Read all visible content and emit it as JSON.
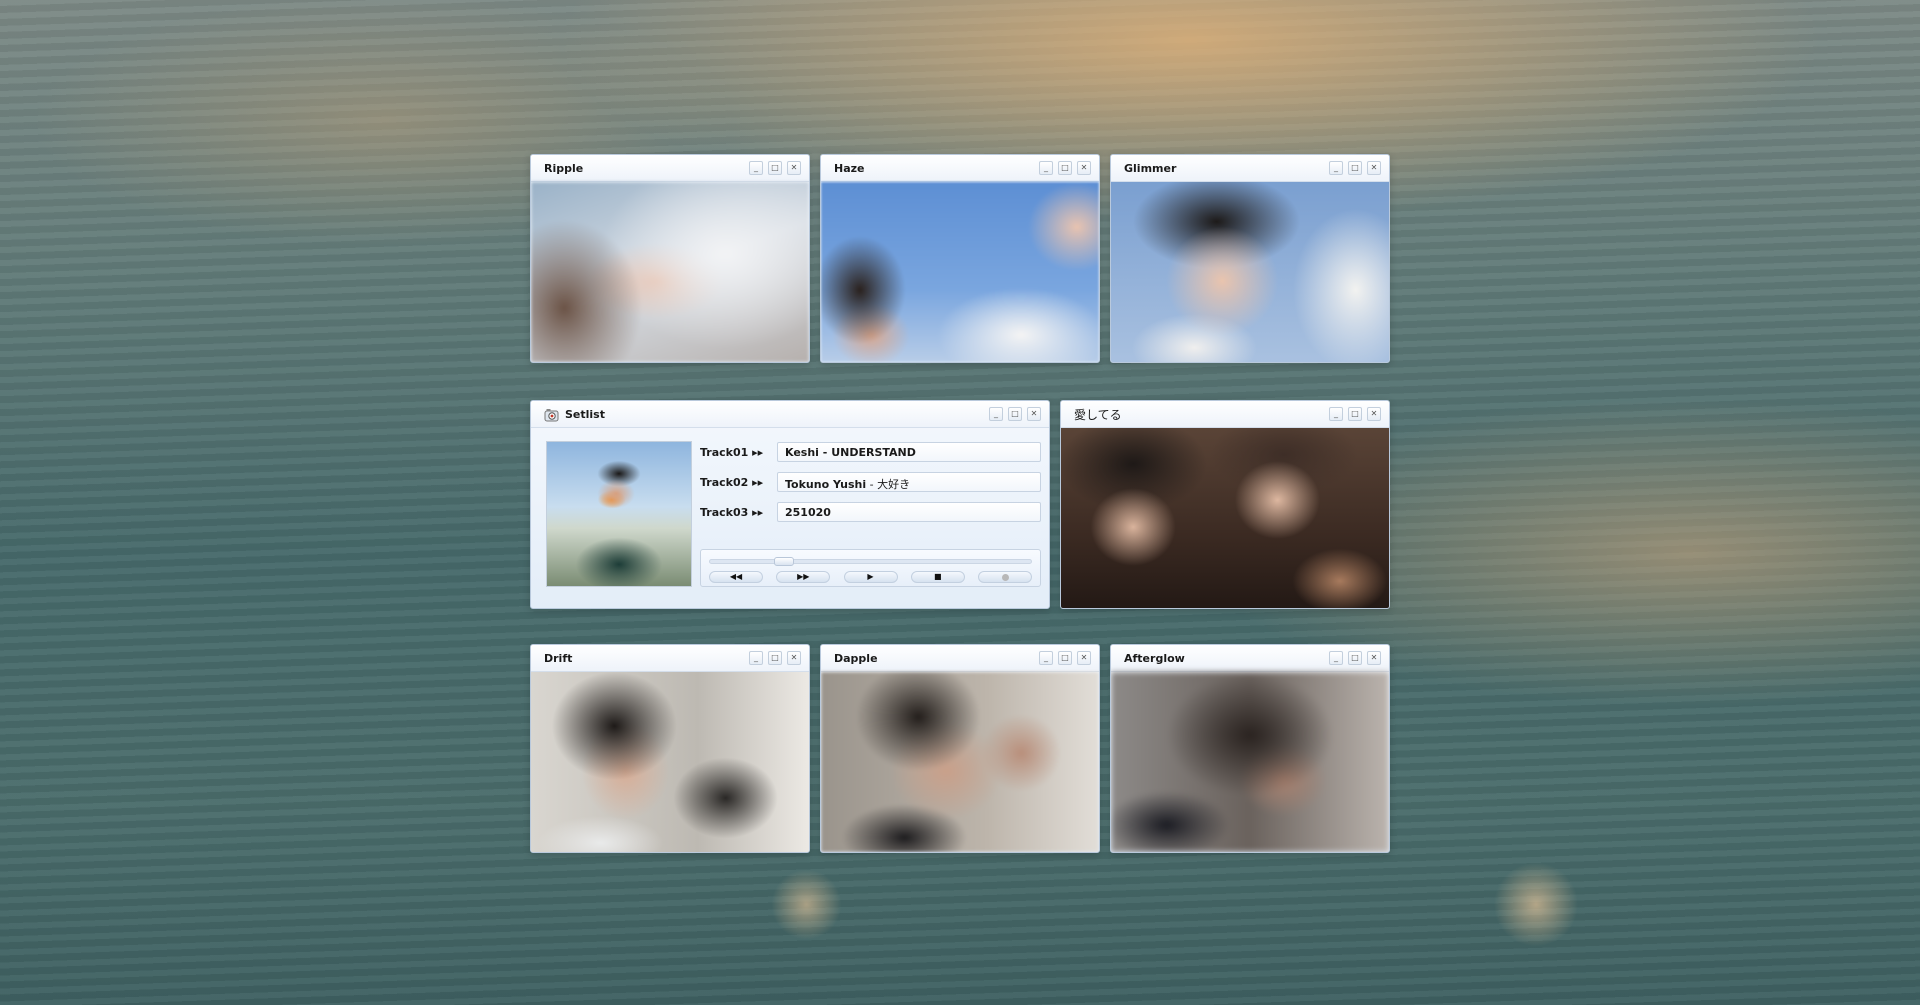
{
  "windows": {
    "ripple": {
      "title": "Ripple"
    },
    "haze": {
      "title": "Haze"
    },
    "glimmer": {
      "title": "Glimmer"
    },
    "aishiteru": {
      "title": "愛してる"
    },
    "drift": {
      "title": "Drift"
    },
    "dapple": {
      "title": "Dapple"
    },
    "afterglow": {
      "title": "Afterglow"
    }
  },
  "window_controls": {
    "minimize": "_",
    "maximize": "□",
    "close": "✕"
  },
  "setlist": {
    "title": "Setlist",
    "tracks": [
      {
        "label": "Track01 ▸▸",
        "artist": "Keshi",
        "separator": " - ",
        "song": "UNDERSTAND"
      },
      {
        "label": "Track02 ▸▸",
        "artist": "Tokuno Yushi",
        "separator": " - ",
        "song": "大好き"
      },
      {
        "label": "Track03 ▸▸",
        "artist": "251020",
        "separator": "",
        "song": ""
      }
    ],
    "player": {
      "seek_position": 0.23,
      "buttons": {
        "rewind": "◀◀",
        "fast_forward": "▶▶",
        "play": "▶",
        "stop": "■"
      }
    }
  },
  "icons": {
    "window_minimize": "minimize-icon",
    "window_maximize": "maximize-icon",
    "window_close": "close-icon",
    "setlist_app": "camera-icon"
  }
}
